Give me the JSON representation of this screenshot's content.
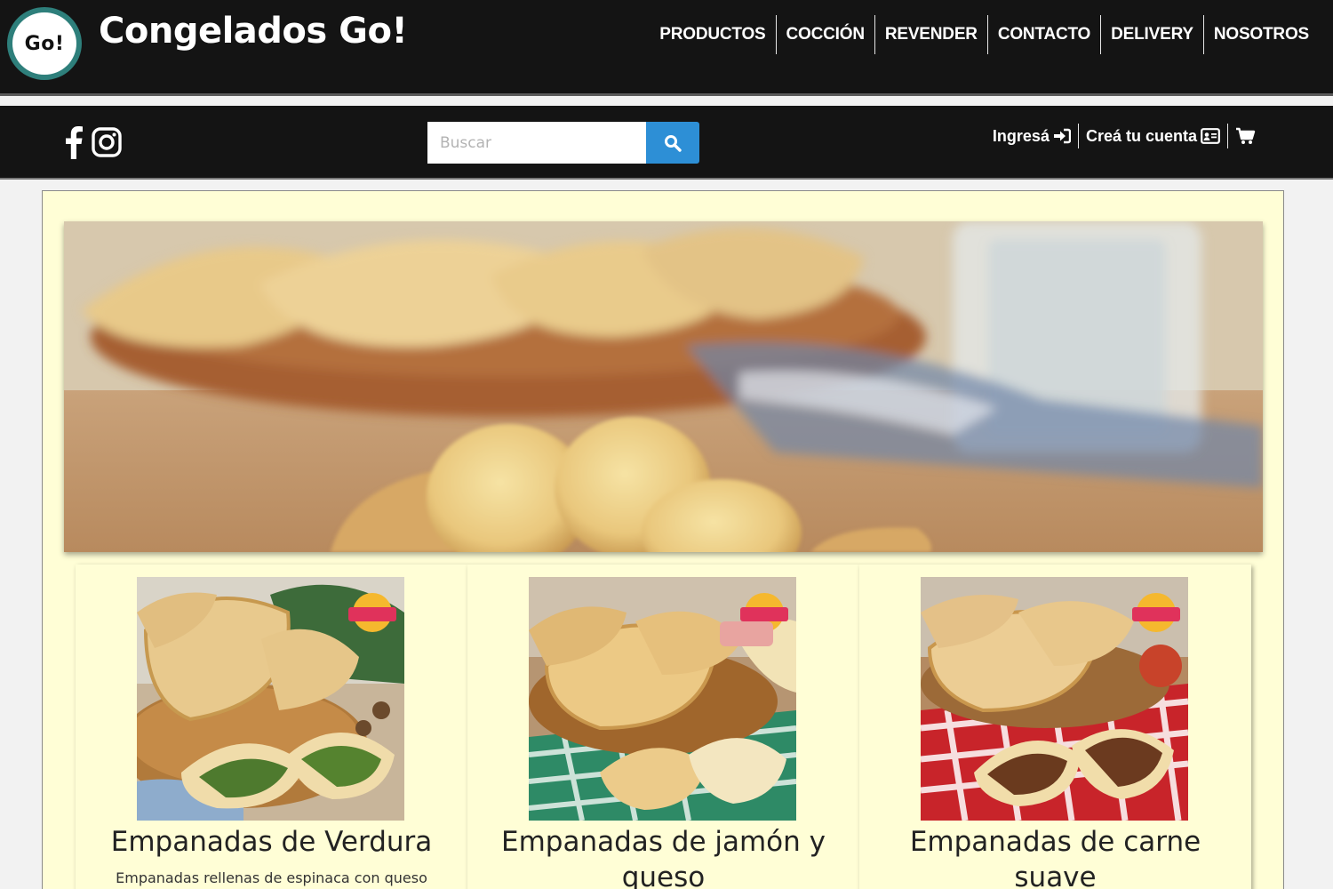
{
  "header": {
    "logo_text": "Go!",
    "brand": "Congelados Go!",
    "nav": [
      "PRODUCTOS",
      "COCCIÓN",
      "REVENDER",
      "CONTACTO",
      "DELIVERY",
      "NOSOTROS"
    ]
  },
  "subbar": {
    "social": [
      "facebook-icon",
      "instagram-icon"
    ],
    "search_placeholder": "Buscar",
    "login_label": "Ingresá",
    "register_label": "Creá tu cuenta",
    "cart_icon": "cart-icon"
  },
  "hero": {
    "alt": "hero-banner-image"
  },
  "products": [
    {
      "title": "Empanadas de Verdura",
      "desc": "Empanadas rellenas de espinaca con queso",
      "accent": "#2f7a3a"
    },
    {
      "title": "Empanadas de jamón y queso",
      "desc": "",
      "accent": "#2b8a6a"
    },
    {
      "title": "Empanadas de carne suave",
      "desc": "",
      "accent": "#c8242a"
    }
  ],
  "colors": {
    "header_bg": "#141414",
    "logo_ring": "#2e7f7b",
    "search_button": "#2d8fd6",
    "content_bg": "#fffed6"
  }
}
